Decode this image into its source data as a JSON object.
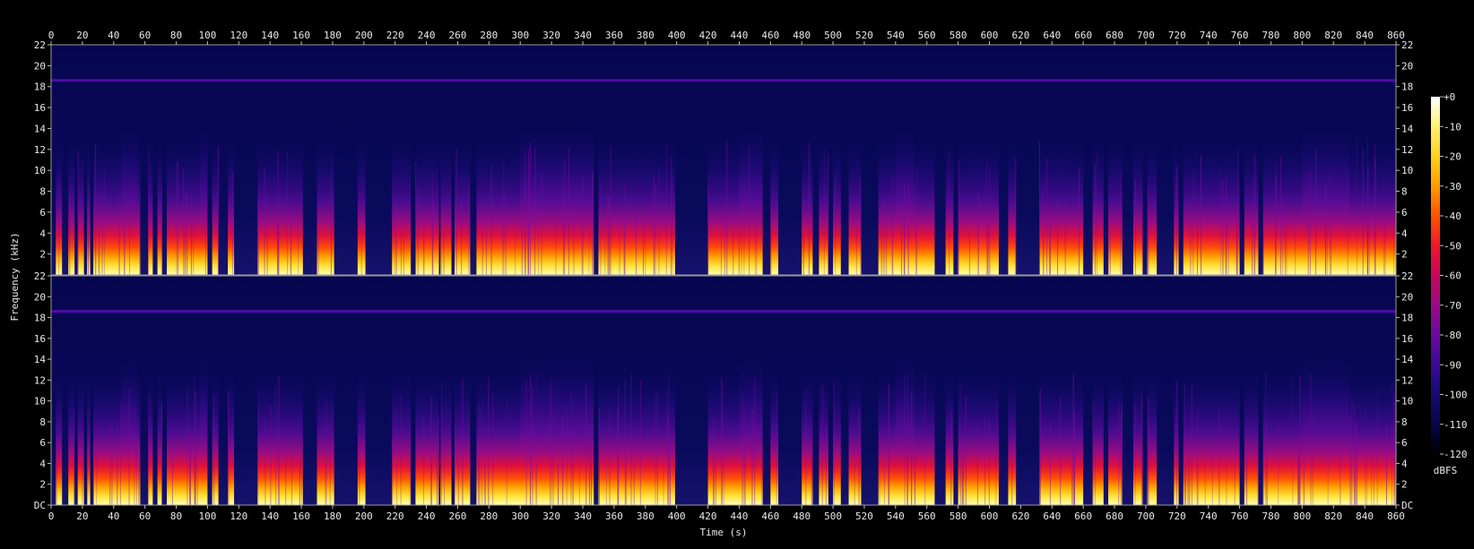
{
  "chart_data": {
    "type": "heatmap",
    "subtype": "spectrogram",
    "channels": 2,
    "xlabel": "Time (s)",
    "ylabel": "Frequency (kHz)",
    "xlim": [
      0,
      860
    ],
    "ylim_khz": [
      0,
      22
    ],
    "x_ticks": [
      0,
      20,
      40,
      60,
      80,
      100,
      120,
      140,
      160,
      180,
      200,
      220,
      240,
      260,
      280,
      300,
      320,
      340,
      360,
      380,
      400,
      420,
      440,
      460,
      480,
      500,
      520,
      540,
      560,
      580,
      600,
      620,
      640,
      660,
      680,
      700,
      720,
      740,
      760,
      780,
      800,
      820,
      840,
      860
    ],
    "y_ticks": [
      "DC",
      "2",
      "4",
      "6",
      "8",
      "10",
      "12",
      "14",
      "16",
      "18",
      "20",
      "22"
    ],
    "y_tick_values_khz": [
      0,
      2,
      4,
      6,
      8,
      10,
      12,
      14,
      16,
      18,
      20,
      22
    ],
    "colorbar": {
      "label": "dBFS",
      "range": [
        -120,
        0
      ],
      "ticks": [
        "+0",
        "-10",
        "-20",
        "-30",
        "-40",
        "-50",
        "-60",
        "-70",
        "-80",
        "-90",
        "-100",
        "-110",
        "-120"
      ],
      "colormap": [
        "#ffffff",
        "#fff070",
        "#ffd21a",
        "#ff9a00",
        "#ff5200",
        "#f0182a",
        "#c8065a",
        "#9a0a86",
        "#6a0aa0",
        "#3a0a96",
        "#180a70",
        "#06064a",
        "#000000"
      ]
    },
    "steady_tone_khz": 18.6,
    "active_segments_s": [
      [
        3,
        7
      ],
      [
        11,
        15
      ],
      [
        17,
        21
      ],
      [
        23,
        25
      ],
      [
        27,
        57
      ],
      [
        62,
        65
      ],
      [
        68,
        71
      ],
      [
        74,
        100
      ],
      [
        103,
        107
      ],
      [
        113,
        117
      ],
      [
        132,
        161
      ],
      [
        170,
        181
      ],
      [
        196,
        201
      ],
      [
        218,
        230
      ],
      [
        233,
        248
      ],
      [
        249,
        256
      ],
      [
        258,
        268
      ],
      [
        272,
        347
      ],
      [
        350,
        399
      ],
      [
        420,
        455
      ],
      [
        460,
        465
      ],
      [
        480,
        487
      ],
      [
        491,
        497
      ],
      [
        500,
        505
      ],
      [
        510,
        518
      ],
      [
        529,
        565
      ],
      [
        572,
        577
      ],
      [
        580,
        606
      ],
      [
        612,
        617
      ],
      [
        632,
        660
      ],
      [
        666,
        673
      ],
      [
        676,
        685
      ],
      [
        692,
        698
      ],
      [
        701,
        707
      ],
      [
        718,
        721
      ],
      [
        724,
        760
      ],
      [
        763,
        772
      ],
      [
        775,
        860
      ]
    ],
    "peak_high_freq_regions_s": [
      [
        45,
        55
      ],
      [
        95,
        100
      ],
      [
        300,
        347
      ],
      [
        440,
        455
      ],
      [
        540,
        552
      ],
      [
        800,
        830
      ]
    ]
  }
}
